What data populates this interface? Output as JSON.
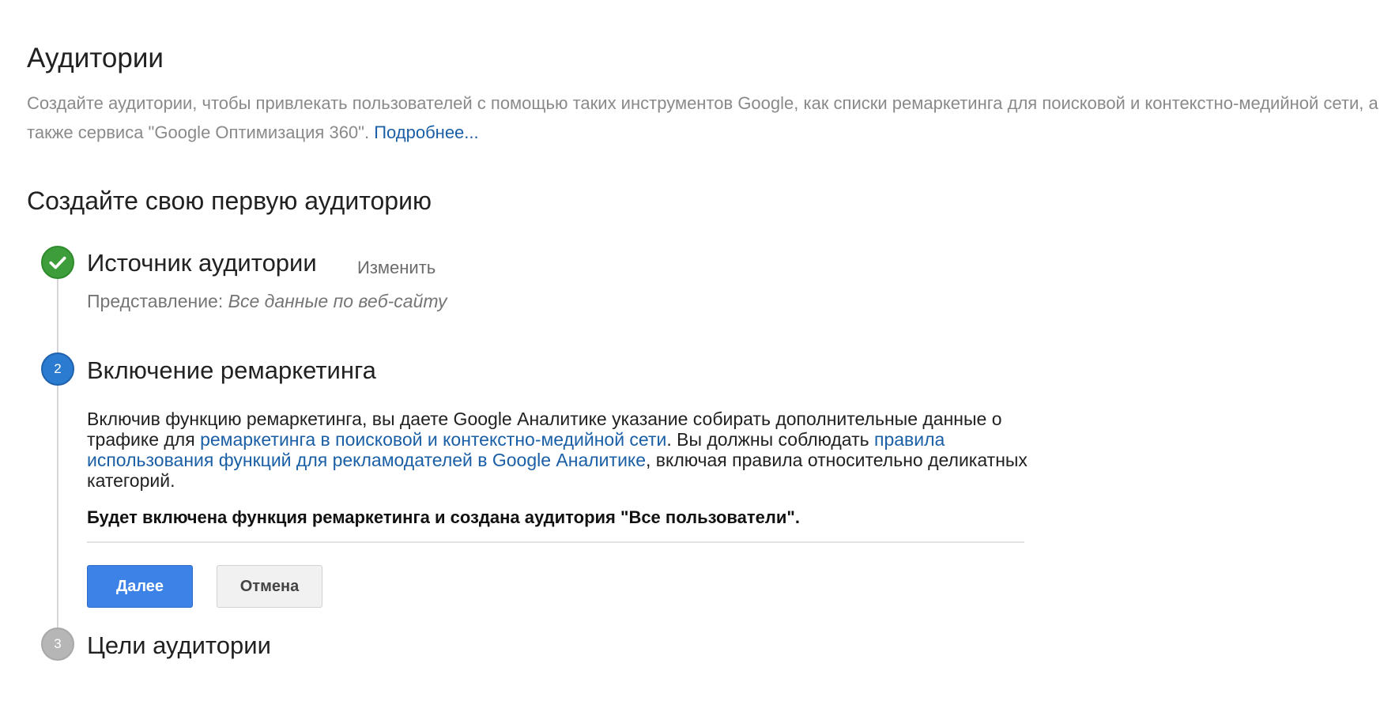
{
  "page": {
    "title": "Аудитории",
    "intro_text": "Создайте аудитории, чтобы привлекать пользователей с помощью таких инструментов Google, как списки ремаркетинга для поисковой и контекстно-медийной сети, а также сервиса \"Google Оптимизация 360\". ",
    "intro_link": "Подробнее...",
    "section_title": "Создайте свою первую аудиторию"
  },
  "steps": {
    "step1": {
      "status": "completed",
      "icon": "checkmark-icon",
      "title": "Источник аудитории",
      "edit_label": "Изменить",
      "view_label": "Представление: ",
      "view_value": "Все данные по веб-сайту"
    },
    "step2": {
      "status": "active",
      "number": "2",
      "title": "Включение ремаркетинга",
      "text_part1": "Включив функцию ремаркетинга, вы даете Google Аналитике указание собирать дополнительные данные о трафике для ",
      "link1": "ремаркетинга в поисковой и контекстно-медийной сети",
      "text_part2": ". Вы должны соблюдать ",
      "link2": "правила использования функций для рекламодателей в Google Аналитике",
      "text_part3": ", включая правила относительно деликатных категорий.",
      "bold_text": "Будет включена функция ремаркетинга и создана аудитория \"Все пользователи\".",
      "next_label": "Далее",
      "cancel_label": "Отмена"
    },
    "step3": {
      "status": "pending",
      "number": "3",
      "title": "Цели аудитории"
    }
  },
  "colors": {
    "link": "#1a5fa6",
    "step_done": "#3d9d3a",
    "step_active": "#2b7bd0",
    "step_pending": "#b6b6b6",
    "primary_button": "#3d82e6"
  }
}
